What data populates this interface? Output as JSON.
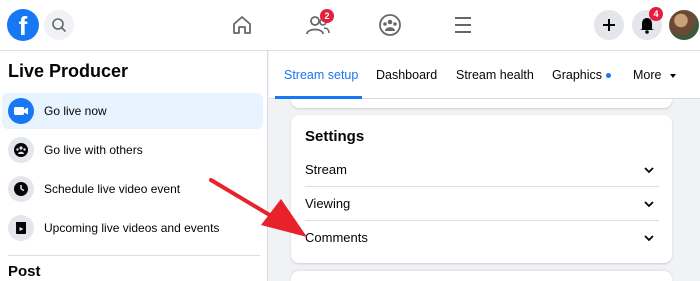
{
  "topbar": {
    "logo_letter": "f",
    "icons": [
      "facebook-logo-icon",
      "search-icon",
      "home-icon",
      "friends-icon",
      "groups-icon",
      "menu-icon",
      "plus-icon",
      "notifications-icon",
      "avatar"
    ],
    "friends_badge": "2",
    "notifications_badge": "4"
  },
  "sidebar": {
    "title": "Live Producer",
    "items": [
      {
        "label": "Go live now",
        "icon": "camera-icon",
        "active": true
      },
      {
        "label": "Go live with others",
        "icon": "people-icon",
        "active": false
      },
      {
        "label": "Schedule live video event",
        "icon": "clock-icon",
        "active": false
      },
      {
        "label": "Upcoming live videos and events",
        "icon": "calendar-icon",
        "active": false
      }
    ],
    "section_title": "Post"
  },
  "tabs": [
    {
      "label": "Stream setup",
      "active": true
    },
    {
      "label": "Dashboard",
      "active": false
    },
    {
      "label": "Stream health",
      "active": false
    },
    {
      "label": "Graphics",
      "active": false,
      "dot": true
    },
    {
      "label": "More",
      "active": false,
      "dropdown": true
    }
  ],
  "settings": {
    "title": "Settings",
    "rows": [
      {
        "label": "Stream"
      },
      {
        "label": "Viewing"
      },
      {
        "label": "Comments"
      }
    ]
  },
  "colors": {
    "brand": "#1877f2",
    "badge": "#e41e3f",
    "arrow": "#e8222a"
  }
}
